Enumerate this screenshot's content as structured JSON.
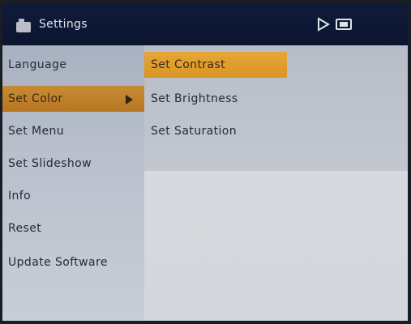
{
  "header": {
    "title": "Settings",
    "icons": [
      "folder-icon",
      "play-icon",
      "memory-card-icon"
    ]
  },
  "menu": {
    "items": [
      {
        "label": "Language"
      },
      {
        "label": "Set Color"
      },
      {
        "label": "Set Menu"
      },
      {
        "label": "Set Slideshow"
      },
      {
        "label": "Info"
      },
      {
        "label": "Reset"
      },
      {
        "label": "Update Software"
      }
    ],
    "selected": "Set Color"
  },
  "submenu": {
    "items": [
      {
        "label": "Set Contrast"
      },
      {
        "label": "Set Brightness"
      },
      {
        "label": "Set Saturation"
      }
    ],
    "selected": "Set Contrast"
  },
  "colors": {
    "header_bg": "#0f1b3a",
    "highlight": "#d99526",
    "menu_bg": "#b9c0cc"
  }
}
